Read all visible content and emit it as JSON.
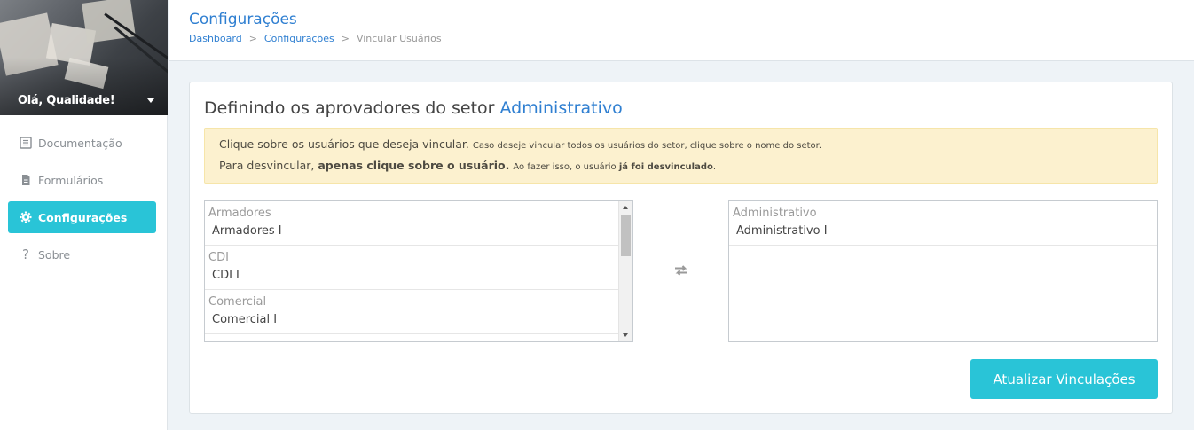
{
  "sidebar": {
    "greeting": "Olá, Qualidade!",
    "items": [
      {
        "label": "Documentação",
        "icon": "book-icon"
      },
      {
        "label": "Formulários",
        "icon": "file-icon"
      },
      {
        "label": "Configurações",
        "icon": "gear-icon",
        "active": true
      },
      {
        "label": "Sobre",
        "icon": "question-icon"
      }
    ]
  },
  "header": {
    "title": "Configurações",
    "breadcrumb": [
      "Dashboard",
      "Configurações",
      "Vincular Usuários"
    ]
  },
  "card": {
    "title_prefix": "Definindo os aprovadores do setor",
    "title_sector": "Administrativo",
    "alert": {
      "line1_main": "Clique sobre os usuários que deseja vincular.",
      "line1_small": "Caso deseje vincular todos os usuários do setor, clique sobre o nome do setor.",
      "line2_pre": "Para desvincular,",
      "line2_bold": "apenas clique sobre o usuário.",
      "line2_small_pre": "Ao fazer isso, o usuário",
      "line2_small_bold": "já foi desvinculado",
      "line2_small_post": "."
    },
    "available_groups": [
      {
        "group": "Armadores",
        "options": [
          "Armadores I"
        ]
      },
      {
        "group": "CDI",
        "options": [
          "CDI I"
        ]
      },
      {
        "group": "Comercial",
        "options": [
          "Comercial I"
        ]
      }
    ],
    "selected_groups": [
      {
        "group": "Administrativo",
        "options": [
          "Administrativo I"
        ]
      }
    ],
    "update_button": "Atualizar Vinculações"
  },
  "colors": {
    "accent": "#29c4d7",
    "link": "#2f7fd1",
    "alert_bg": "#fcf1cf"
  }
}
